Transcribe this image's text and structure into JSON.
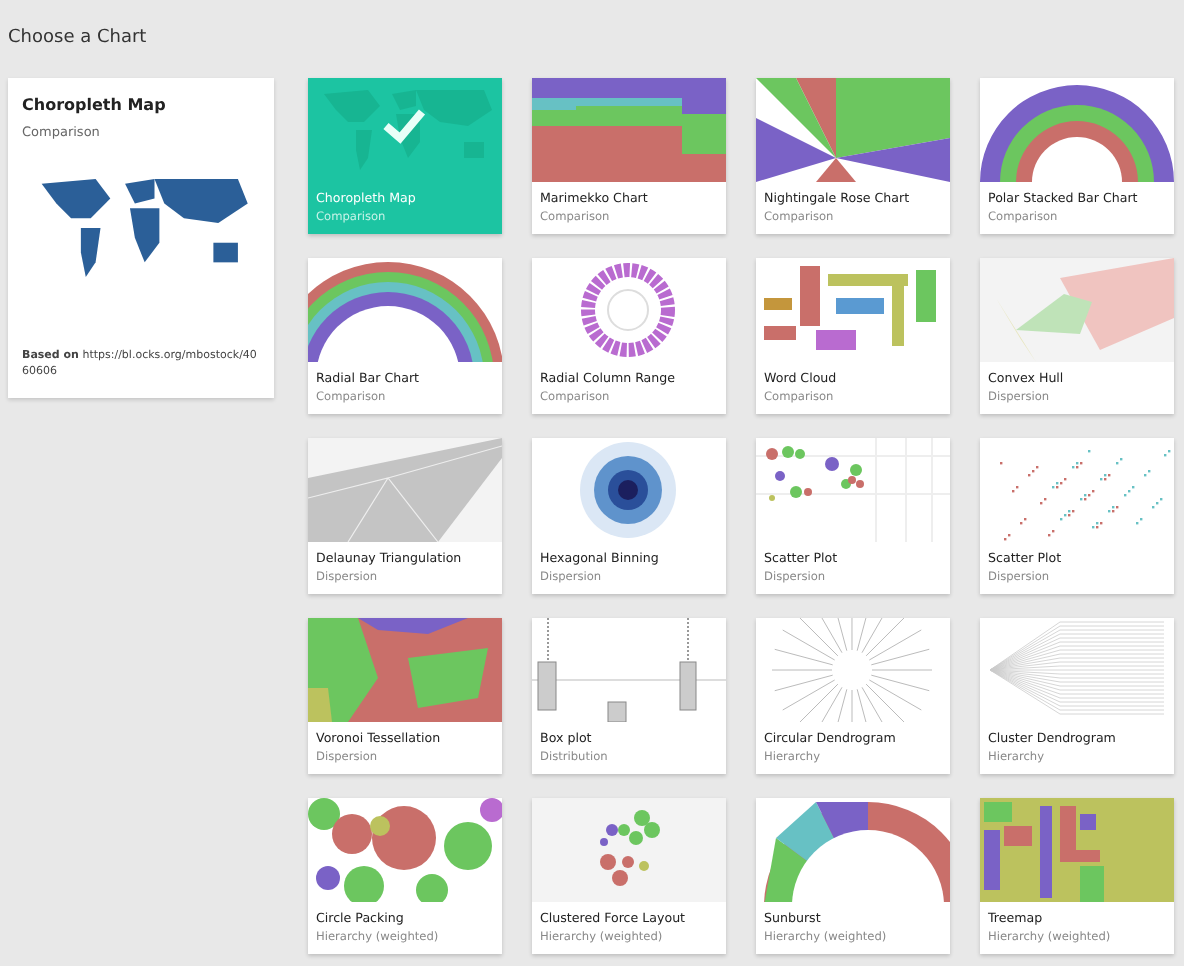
{
  "page_title": "Choose a Chart",
  "preview": {
    "title": "Choropleth Map",
    "category": "Comparison",
    "source": "**Based on** https://bl.ocks.org/mbostock/4060606"
  },
  "charts": [
    {
      "kind": "map",
      "title": "Choropleth Map",
      "category": "Comparison",
      "selected": true
    },
    {
      "kind": "mekko",
      "title": "Marimekko Chart",
      "category": "Comparison",
      "selected": false
    },
    {
      "kind": "rose",
      "title": "Nightingale Rose Chart",
      "category": "Comparison",
      "selected": false
    },
    {
      "kind": "polar",
      "title": "Polar Stacked Bar Chart",
      "category": "Comparison",
      "selected": false
    },
    {
      "kind": "radial",
      "title": "Radial Bar Chart",
      "category": "Comparison",
      "selected": false
    },
    {
      "kind": "columnrange",
      "title": "Radial Column Range",
      "category": "Comparison",
      "selected": false
    },
    {
      "kind": "words",
      "title": "Word Cloud",
      "category": "Comparison",
      "selected": false
    },
    {
      "kind": "hull",
      "title": "Convex Hull",
      "category": "Dispersion",
      "selected": false
    },
    {
      "kind": "delaunay",
      "title": "Delaunay Triangulation",
      "category": "Dispersion",
      "selected": false
    },
    {
      "kind": "hexbin",
      "title": "Hexagonal Binning",
      "category": "Dispersion",
      "selected": false
    },
    {
      "kind": "bubbles",
      "title": "Scatter Plot",
      "category": "Dispersion",
      "selected": false
    },
    {
      "kind": "dots",
      "title": "Scatter Plot",
      "category": "Dispersion",
      "selected": false
    },
    {
      "kind": "voronoi",
      "title": "Voronoi Tessellation",
      "category": "Dispersion",
      "selected": false
    },
    {
      "kind": "boxplot",
      "title": "Box plot",
      "category": "Distribution",
      "selected": false
    },
    {
      "kind": "circdendro",
      "title": "Circular Dendrogram",
      "category": "Hierarchy",
      "selected": false
    },
    {
      "kind": "clusterdendro",
      "title": "Cluster Dendrogram",
      "category": "Hierarchy",
      "selected": false
    },
    {
      "kind": "packing",
      "title": "Circle Packing",
      "category": "Hierarchy (weighted)",
      "selected": false
    },
    {
      "kind": "force",
      "title": "Clustered Force Layout",
      "category": "Hierarchy (weighted)",
      "selected": false
    },
    {
      "kind": "sunburst",
      "title": "Sunburst",
      "category": "Hierarchy (weighted)",
      "selected": false
    },
    {
      "kind": "treemap",
      "title": "Treemap",
      "category": "Hierarchy (weighted)",
      "selected": false
    }
  ]
}
